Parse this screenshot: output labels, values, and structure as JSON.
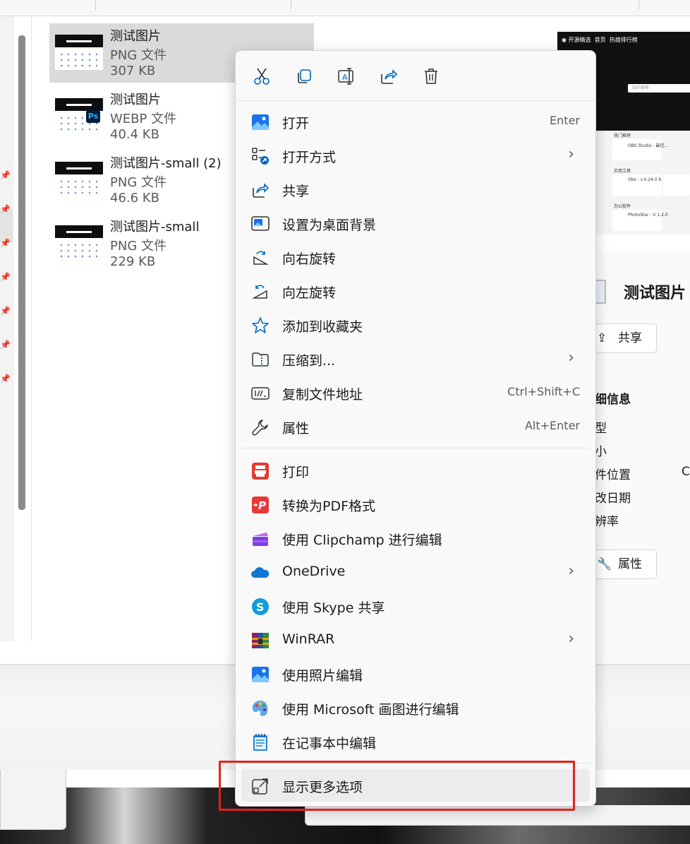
{
  "files": [
    {
      "name": "测试图片",
      "type": "PNG 文件",
      "size": "307 KB",
      "selected": true,
      "badge": ""
    },
    {
      "name": "测试图片",
      "type": "WEBP 文件",
      "size": "40.4 KB",
      "selected": false,
      "badge": "Ps"
    },
    {
      "name": "测试图片-small (2)",
      "type": "PNG 文件",
      "size": "46.6 KB",
      "selected": false,
      "badge": ""
    },
    {
      "name": "测试图片-small",
      "type": "PNG 文件",
      "size": "229 KB",
      "selected": false,
      "badge": ""
    }
  ],
  "details": {
    "title": "测试图片",
    "share_label": "共享",
    "section_title": "细信息",
    "labels": [
      "型",
      "小",
      "件位置",
      "改日期",
      "辨率"
    ],
    "location_value_partial": "C",
    "properties_label": "属性"
  },
  "preview": {
    "site_name": "开源精选",
    "tab1": "首页",
    "tab2": "热搜排行榜",
    "search_placeholder": "站内搜索",
    "section1": "热门推荐",
    "section2": "实用工具",
    "section3": "办公软件",
    "card1": "OBS Studio - 最佳...",
    "card2": "Obs - v.0.24.0 b",
    "card3": "PhotoStar - V 1.2.0"
  },
  "context_menu": {
    "quick_actions": [
      {
        "name": "cut",
        "icon": "scissors-icon"
      },
      {
        "name": "copy",
        "icon": "copy-icon"
      },
      {
        "name": "rename",
        "icon": "rename-icon"
      },
      {
        "name": "share",
        "icon": "share-icon"
      },
      {
        "name": "delete",
        "icon": "trash-icon"
      }
    ],
    "items": [
      {
        "label": "打开",
        "shortcut": "Enter",
        "icon": "photos-icon",
        "submenu": false
      },
      {
        "label": "打开方式",
        "shortcut": "",
        "icon": "open-with-icon",
        "submenu": true
      },
      {
        "label": "共享",
        "shortcut": "",
        "icon": "share-icon",
        "submenu": false
      },
      {
        "label": "设置为桌面背景",
        "shortcut": "",
        "icon": "wallpaper-icon",
        "submenu": false
      },
      {
        "label": "向右旋转",
        "shortcut": "",
        "icon": "rotate-right-icon",
        "submenu": false
      },
      {
        "label": "向左旋转",
        "shortcut": "",
        "icon": "rotate-left-icon",
        "submenu": false
      },
      {
        "label": "添加到收藏夹",
        "shortcut": "",
        "icon": "star-icon",
        "submenu": false
      },
      {
        "label": "压缩到...",
        "shortcut": "",
        "icon": "zip-icon",
        "submenu": true
      },
      {
        "label": "复制文件地址",
        "shortcut": "Ctrl+Shift+C",
        "icon": "copy-path-icon",
        "submenu": false
      },
      {
        "label": "属性",
        "shortcut": "Alt+Enter",
        "icon": "wrench-icon",
        "submenu": false
      }
    ],
    "items2": [
      {
        "label": "打印",
        "shortcut": "",
        "icon": "print-icon",
        "submenu": false
      },
      {
        "label": "转换为PDF格式",
        "shortcut": "",
        "icon": "pdf-icon",
        "submenu": false
      },
      {
        "label": "使用 Clipchamp 进行编辑",
        "shortcut": "",
        "icon": "clipchamp-icon",
        "submenu": false
      },
      {
        "label": "OneDrive",
        "shortcut": "",
        "icon": "onedrive-icon",
        "submenu": true
      },
      {
        "label": "使用 Skype 共享",
        "shortcut": "",
        "icon": "skype-icon",
        "submenu": false
      },
      {
        "label": "WinRAR",
        "shortcut": "",
        "icon": "winrar-icon",
        "submenu": true
      },
      {
        "label": "使用照片编辑",
        "shortcut": "",
        "icon": "photos-icon",
        "submenu": false
      },
      {
        "label": "使用 Microsoft 画图进行编辑",
        "shortcut": "",
        "icon": "paint-icon",
        "submenu": false
      },
      {
        "label": "在记事本中编辑",
        "shortcut": "",
        "icon": "notepad-icon",
        "submenu": false
      }
    ],
    "more_options": {
      "label": "显示更多选项",
      "icon": "more-options-icon"
    }
  },
  "colors": {
    "highlight_box": "#e2231a",
    "accent": "#0067c0"
  }
}
